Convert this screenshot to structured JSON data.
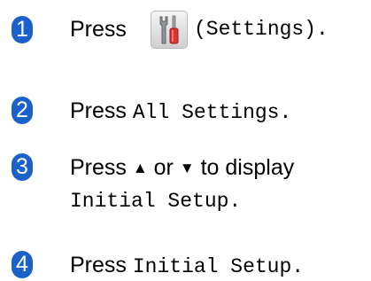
{
  "steps": [
    {
      "number": "1",
      "press": "Press",
      "button_label": "(Settings).",
      "icon": "settings-tools-icon"
    },
    {
      "number": "2",
      "press": "Press",
      "menu_item": "All Settings."
    },
    {
      "number": "3",
      "press": "Press",
      "up": "▲",
      "or": "or",
      "down": "▼",
      "to_display": "to display",
      "menu_item": "Initial Setup."
    },
    {
      "number": "4",
      "press": "Press",
      "menu_item": "Initial Setup."
    }
  ],
  "colors": {
    "badge": "#1a62c9"
  }
}
